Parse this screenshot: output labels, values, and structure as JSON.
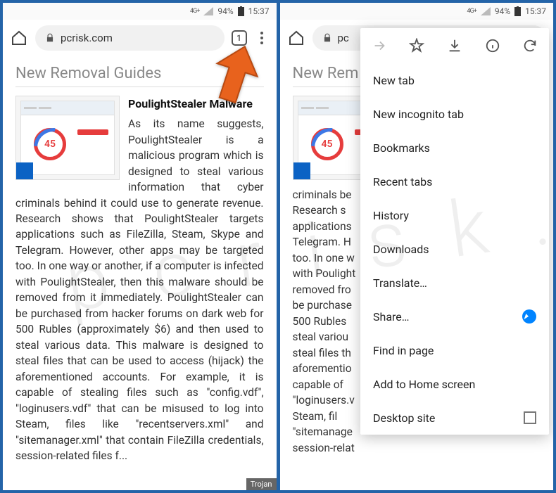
{
  "status": {
    "net": "4G+",
    "battery": "94%",
    "time": "15:37"
  },
  "addr": {
    "url": "pcrisk.com",
    "url_short": "pc",
    "tabs": "1"
  },
  "page": {
    "heading": "New Removal Guides",
    "heading_short": "New Rem",
    "title": "PoulightStealer Malware",
    "gauge": "45",
    "body": "As its name suggests, PoulightStealer is a malicious program which is designed to steal various information that cyber criminals behind it could use to generate revenue. Research shows that PoulightStealer targets applications such as FileZilla, Steam, Skype and Telegram. However, other apps may be targeted too. In one way or another, if a computer is infected with PoulightStealer, then this malware should be removed from it immediately. PoulightStealer can be purchased from hacker forums on dark web for 500 Rubles (approximately $6) and then used to steal various data. This malware is designed to steal files that can be used to access (hijack) the aforementioned accounts. For example, it is capable of stealing files such as \"config.vdf\", \"loginusers.vdf\" that can be misused to log into Steam, files like \"recentservers.xml\" and \"sitemanager.xml\" that contain FileZilla credentials, session-related files f...",
    "body_r": "criminals be\nResearch s\napplications\nTelegram. H\ntoo. In one w\nwith Poulight\nremoved fro\nbe purchase\n500 Rubles\nsteal variou\nsteal files th\naforementio\ncapable of \n\"loginusers.v\nSteam, fil\n\"sitemanage\nsession-relat",
    "tag": "Trojan"
  },
  "menu": {
    "new_tab": "New tab",
    "incognito": "New incognito tab",
    "bookmarks": "Bookmarks",
    "recent": "Recent tabs",
    "history": "History",
    "downloads": "Downloads",
    "translate": "Translate…",
    "share": "Share…",
    "find": "Find in page",
    "add_home": "Add to Home screen",
    "desktop": "Desktop site"
  }
}
